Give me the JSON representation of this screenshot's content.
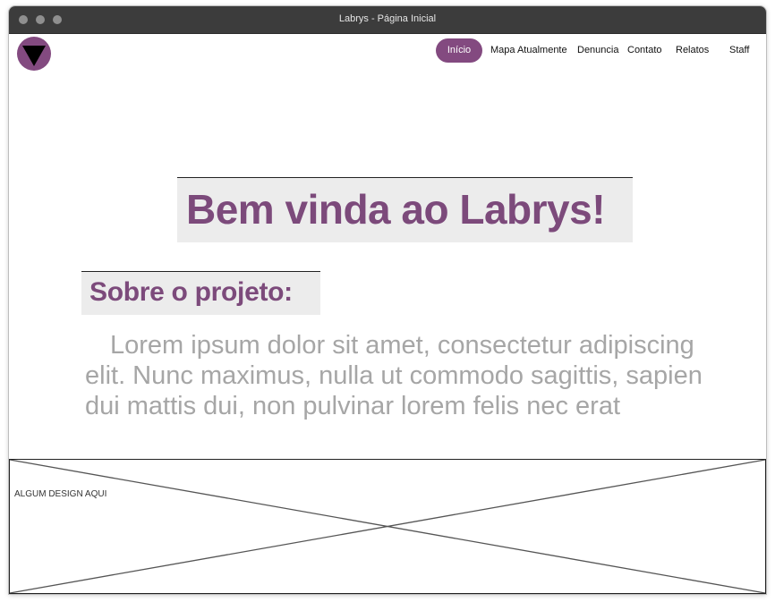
{
  "window": {
    "title": "Labrys - Página Inicial"
  },
  "header": {
    "logo_icon": "triangle-down-icon",
    "nav": [
      {
        "label": "Início",
        "active": true
      },
      {
        "label": "Mapa Atualmente",
        "active": false
      },
      {
        "label": "Denuncia",
        "active": false
      },
      {
        "label": "Contato",
        "active": false
      },
      {
        "label": "Relatos",
        "active": false
      },
      {
        "label": "Staff",
        "active": false
      }
    ]
  },
  "hero": {
    "title": "Bem vinda ao Labrys!"
  },
  "about": {
    "heading": "Sobre o projeto:",
    "text": "Lorem ipsum dolor sit amet, consectetur adipiscing elit. Nunc maximus, nulla ut commodo sagittis, sapien dui mattis dui, non pulvinar lorem felis nec erat"
  },
  "footer_placeholder": {
    "label": "ALGUM DESIGN AQUI"
  },
  "colors": {
    "accent": "#834a80",
    "heading": "#7c4a7b",
    "body_text": "#a6a6a6",
    "titlebar": "#3c3c3c",
    "box_bg": "#ececec"
  }
}
